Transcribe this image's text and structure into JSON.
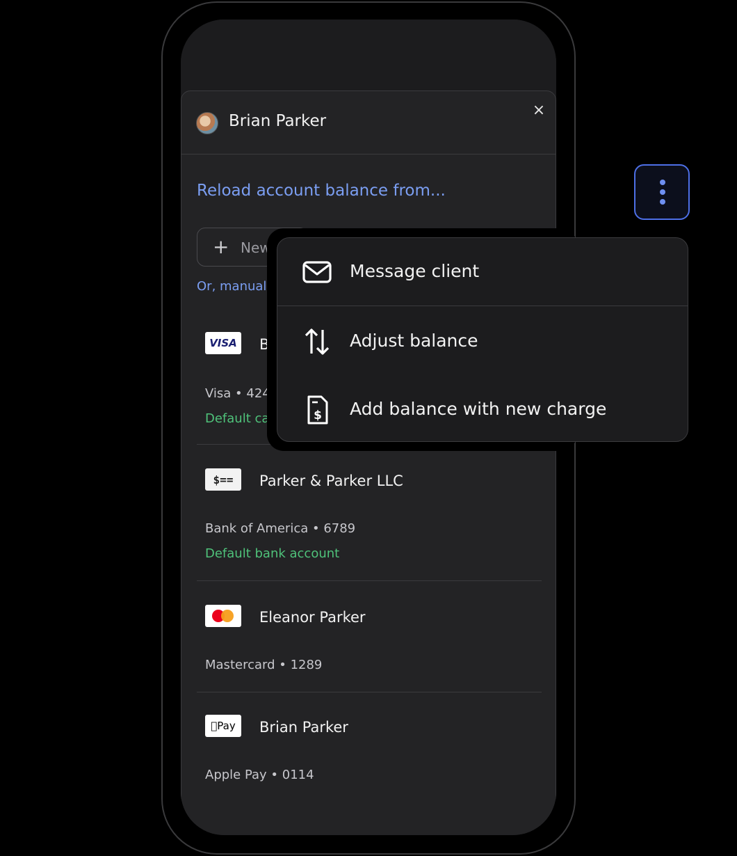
{
  "sheet": {
    "client_name": "Brian Parker",
    "close_icon": "×",
    "reload_title": "Reload account balance from...",
    "new_button_label": "New",
    "manual_link": "Or, manually"
  },
  "payment_methods": [
    {
      "logo": "VISA",
      "title": "B",
      "sub": "Visa • 4242",
      "default": "Default card"
    },
    {
      "logo": "$==",
      "title": "Parker & Parker LLC",
      "sub": "Bank of America • 6789",
      "default": "Default bank account"
    },
    {
      "logo": "mastercard",
      "title": "Eleanor Parker",
      "sub": "Mastercard • 1289"
    },
    {
      "logo": "Pay",
      "title": "Brian Parker",
      "sub": "Apple Pay • 0114"
    }
  ],
  "menu": {
    "items": [
      {
        "label": "Message client",
        "icon": "envelope-icon"
      },
      {
        "label": "Adjust balance",
        "icon": "arrows-up-down-icon"
      },
      {
        "label": "Add balance with new charge",
        "icon": "invoice-dollar-icon"
      }
    ]
  },
  "colors": {
    "accent": "#7b9ef2",
    "default_green": "#4fc27a",
    "button_border": "#4d6fe6"
  }
}
